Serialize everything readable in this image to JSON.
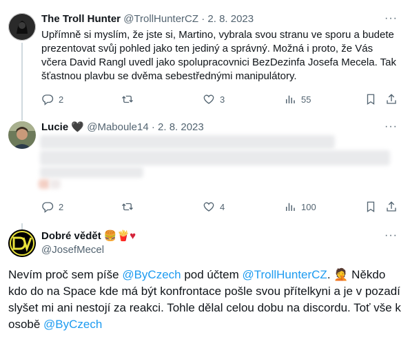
{
  "tweets": [
    {
      "name": "The Troll Hunter",
      "handle": "@TrollHunterCZ",
      "date": "2. 8. 2023",
      "text": "Upřímně si myslím, že jste si, Martino, vybrala svou stranu ve sporu a budete prezentovat svůj pohled jako ten jediný a správný. Možná i proto, že Vás včera David Rangl uvedl jako spolupracovnici BezDezinfa Josefa Mecela. Tak šťastnou plavbu se dvěma sebestřednými manipulátory.",
      "replies": "2",
      "retweets": "",
      "likes": "3",
      "views": "55"
    },
    {
      "name": "Lucie",
      "name_emoji": "🖤",
      "handle": "@Maboule14",
      "date": "2. 8. 2023",
      "replies": "2",
      "retweets": "",
      "likes": "4",
      "views": "100"
    }
  ],
  "main_tweet": {
    "name": "Dobré vědět",
    "name_emojis": "🍔🍟♥",
    "handle": "@JosefMecel",
    "text_1": "Nevím proč sem píše ",
    "mention_1": "@ByCzech",
    "text_2": " pod účtem ",
    "mention_2": "@TrollHunterCZ",
    "text_3": ". 🤦 Někdo kdo do na Space kde má být konfrontace pošle svou přítelkyni a je v pozadí slyšet mi ani nestojí za reakci. Tohle dělal celou dobu na discordu. Toť vše k osobě ",
    "mention_3": "@ByCzech",
    "avatar_text": "DV"
  },
  "ui": {
    "separator": "·",
    "more": "···"
  },
  "colors": {
    "link": "#1d9bf0",
    "secondary_text": "#536471",
    "thread_line": "#cfd9de",
    "avatar_bg": "#000000",
    "avatar_accent": "#e8e23a"
  },
  "icons": [
    "reply-icon",
    "retweet-icon",
    "like-icon",
    "views-icon",
    "bookmark-icon",
    "share-icon",
    "more-icon"
  ]
}
